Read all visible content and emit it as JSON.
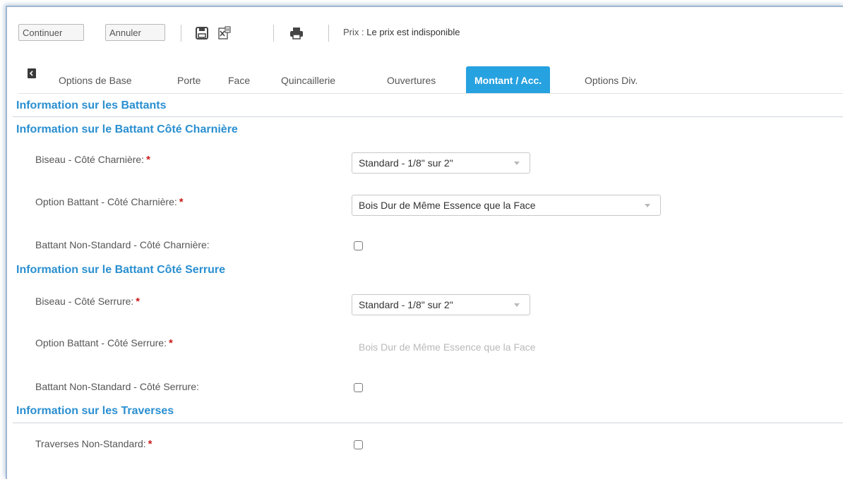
{
  "toolbar": {
    "continue_label": "Continuer",
    "cancel_label": "Annuler",
    "price_label": "Prix :",
    "price_value": "Le prix est indisponible"
  },
  "tabs": [
    {
      "label": "Options de Base",
      "active": false
    },
    {
      "label": "Porte",
      "active": false
    },
    {
      "label": "Face",
      "active": false
    },
    {
      "label": "Quincaillerie",
      "active": false
    },
    {
      "label": "Ouvertures",
      "active": false
    },
    {
      "label": "Montant / Acc.",
      "active": true
    },
    {
      "label": "Options Div.",
      "active": false
    }
  ],
  "sections": {
    "battants_title": "Information sur les Battants",
    "charniere_title": "Information sur le Battant Côté Charnière",
    "serrure_title": "Information sur le Battant Côté Serrure",
    "traverses_title": "Information sur les Traverses"
  },
  "fields": {
    "biseau_charniere": {
      "label": "Biseau - Côté Charnière:",
      "required_mark": "*",
      "value": "Standard - 1/8\" sur 2\""
    },
    "option_charniere": {
      "label": "Option Battant - Côté Charnière:",
      "required_mark": "*",
      "value": "Bois Dur de Même Essence que la Face"
    },
    "nonstd_charniere": {
      "label": "Battant Non-Standard - Côté Charnière:",
      "checked": false
    },
    "biseau_serrure": {
      "label": "Biseau - Côté Serrure:",
      "required_mark": "*",
      "value": "Standard - 1/8\" sur 2\""
    },
    "option_serrure": {
      "label": "Option Battant - Côté Serrure:",
      "required_mark": "*",
      "value": "Bois Dur de Même Essence que la Face"
    },
    "nonstd_serrure": {
      "label": "Battant Non-Standard - Côté Serrure:",
      "checked": false
    },
    "traverses_nonstd": {
      "label": "Traverses Non-Standard:",
      "required_mark": "*",
      "checked": false
    }
  },
  "colors": {
    "accent": "#27a2e0",
    "section_title": "#2a8fd0",
    "required": "#cc1a1a"
  },
  "icons": [
    "save-icon",
    "excel-export-icon",
    "print-icon",
    "back-icon"
  ]
}
